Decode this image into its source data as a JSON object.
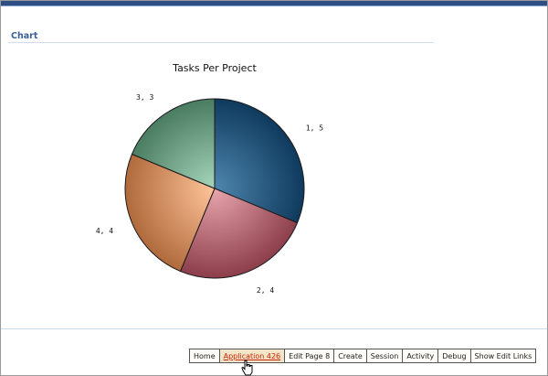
{
  "region": {
    "title": "Chart"
  },
  "chart_data": {
    "type": "pie",
    "title": "Tasks Per Project",
    "start_angle_deg": 0,
    "slices": [
      {
        "label": "1, 5",
        "value": 5,
        "color_outer": "#0f3a5e",
        "color_inner": "#4f86ad"
      },
      {
        "label": "2, 4",
        "value": 4,
        "color_outer": "#8c3e4b",
        "color_inner": "#e8a6ad"
      },
      {
        "label": "4, 4",
        "value": 4,
        "color_outer": "#b06a3c",
        "color_inner": "#ffc49a"
      },
      {
        "label": "3, 3",
        "value": 3,
        "color_outer": "#4a7c62",
        "color_inner": "#a6d6bb"
      }
    ]
  },
  "dev_toolbar": {
    "items": [
      {
        "label": "Home",
        "active": false
      },
      {
        "label": "Application 426",
        "active": true
      },
      {
        "label": "Edit Page 8",
        "active": false
      },
      {
        "label": "Create",
        "active": false
      },
      {
        "label": "Session",
        "active": false
      },
      {
        "label": "Activity",
        "active": false
      },
      {
        "label": "Debug",
        "active": false
      },
      {
        "label": "Show Edit Links",
        "active": false
      }
    ]
  }
}
